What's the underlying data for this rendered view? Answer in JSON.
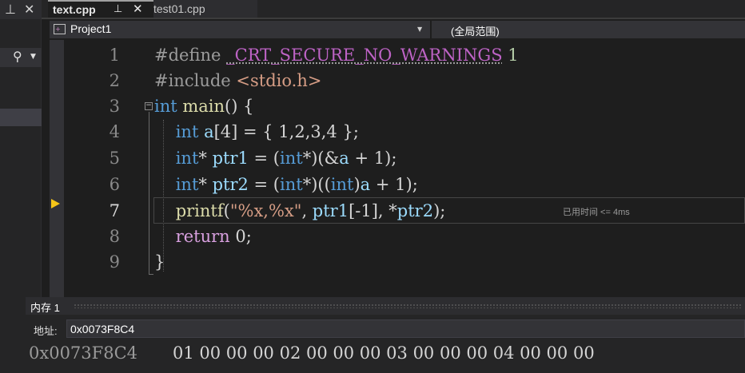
{
  "tabs": [
    {
      "label": "text.cpp",
      "active": true,
      "pinned": true
    },
    {
      "label": "test01.cpp",
      "active": false
    }
  ],
  "icons": {
    "panel_pin": "pin-icon",
    "panel_close": "close-icon",
    "search": "search-icon",
    "dropdown": "chevron-down-icon",
    "current_statement": "instruction-pointer-arrow-icon"
  },
  "nav": {
    "project": "Project1",
    "scope": "(全局范围)"
  },
  "editor": {
    "line_numbers": [
      "1",
      "2",
      "3",
      "4",
      "5",
      "6",
      "7",
      "8",
      "9"
    ],
    "current_line": "7",
    "perf_tip": "已用时间 <= 4ms",
    "line1": {
      "directive": "#define",
      "macro": "_CRT_SECURE_NO_WARNINGS",
      "value": " 1"
    },
    "line2": {
      "directive": "#include",
      "file": " <stdio.h>"
    },
    "line3": {
      "type": "int",
      "name": " main",
      "rest": "() {"
    },
    "line4": {
      "indent": "    ",
      "type": "int",
      "var": " a",
      "rest": "[4] = { 1,2,3,4 };"
    },
    "line5": {
      "indent": "    ",
      "type": "int",
      "star": "* ",
      "var": "ptr1",
      "eq": " = (",
      "cast": "int",
      "rest1": "*)(&",
      "var2": "a",
      "rest2": " + 1);"
    },
    "line6": {
      "indent": "    ",
      "type": "int",
      "star": "* ",
      "var": "ptr2",
      "eq": " = (",
      "cast": "int",
      "rest1": "*)((",
      "cast2": "int",
      "rest2": ")",
      "var2": "a",
      "rest3": " + 1);"
    },
    "line7": {
      "indent": "    ",
      "fn": "printf",
      "open": "(",
      "str": "\"%x,%x\"",
      "comma": ", ",
      "var": "ptr1",
      "idx": "[-1], *",
      "var2": "ptr2",
      "close": ");"
    },
    "line8": {
      "indent": "    ",
      "kw": "return",
      "rest": " 0;"
    },
    "line9": {
      "rest": "}"
    }
  },
  "memory": {
    "title": "内存 1",
    "address_label": "地址:",
    "address_value": "0x0073F8C4",
    "row_address": "0x0073F8C4",
    "row_bytes": "01 00 00 00 02 00 00 00 03 00 00 00 04 00 00 00"
  }
}
